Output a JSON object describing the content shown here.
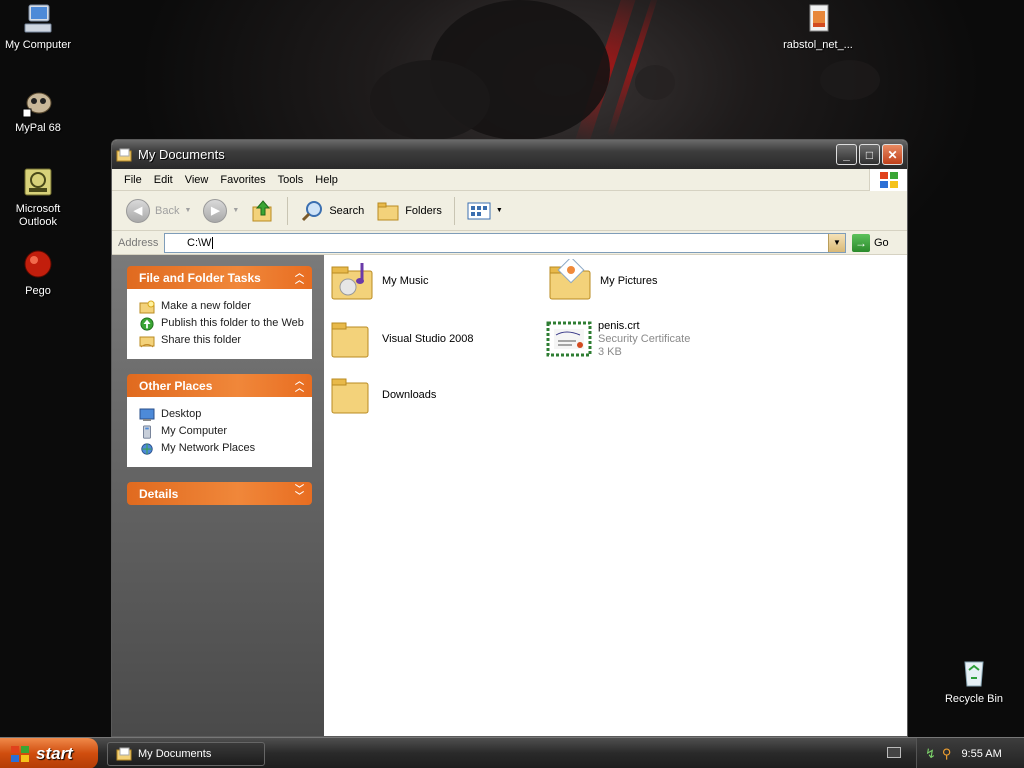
{
  "desktop": {
    "icons": [
      {
        "label": "My Computer",
        "icon": "my-computer-icon"
      },
      {
        "label": "MyPal 68",
        "icon": "mypal-icon"
      },
      {
        "label": "Microsoft Outlook",
        "icon": "outlook-icon"
      },
      {
        "label": "Pego",
        "icon": "pego-icon"
      },
      {
        "label": "rabstol_net_...",
        "icon": "archive-icon"
      },
      {
        "label": "Recycle Bin",
        "icon": "recycle-bin-icon"
      }
    ]
  },
  "window": {
    "title": "My Documents",
    "menu": [
      "File",
      "Edit",
      "View",
      "Favorites",
      "Tools",
      "Help"
    ],
    "toolbar": {
      "back": "Back",
      "search": "Search",
      "folders": "Folders"
    },
    "address": {
      "label": "Address",
      "value": "C:\\W",
      "go": "Go"
    },
    "tasks": {
      "file_folder": {
        "title": "File and Folder Tasks",
        "items": [
          "Make a new folder",
          "Publish this folder to the Web",
          "Share this folder"
        ]
      },
      "other_places": {
        "title": "Other Places",
        "items": [
          "Desktop",
          "My Computer",
          "My Network Places"
        ]
      },
      "details": {
        "title": "Details"
      }
    },
    "files": [
      {
        "name": "My Music",
        "icon": "music-folder-icon"
      },
      {
        "name": "My Pictures",
        "icon": "pictures-folder-icon"
      },
      {
        "name": "Visual Studio 2008",
        "icon": "folder-icon"
      },
      {
        "name": "penis.crt",
        "type": "Security Certificate",
        "size": "3 KB",
        "icon": "certificate-icon"
      },
      {
        "name": "Downloads",
        "icon": "folder-icon"
      }
    ]
  },
  "taskbar": {
    "start": "start",
    "task_button": "My Documents",
    "clock": "9:55 AM"
  },
  "colors": {
    "accent": "#e06a1f",
    "title_bar": "#3c3c3c",
    "taskbar": "#2a2a2a"
  }
}
